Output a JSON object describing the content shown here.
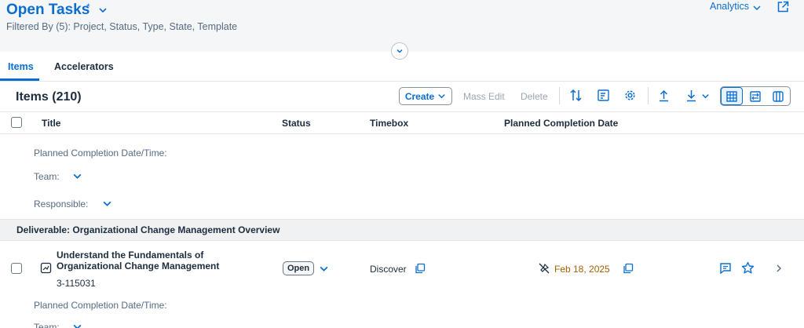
{
  "header": {
    "title": "Open Tasks",
    "title_marker": "*",
    "filter_text": "Filtered By (5): Project, Status, Type, State, Template",
    "analytics_label": "Analytics"
  },
  "tabs": [
    {
      "label": "Items",
      "selected": true
    },
    {
      "label": "Accelerators",
      "selected": false
    }
  ],
  "toolbar": {
    "title": "Items (210)",
    "create_label": "Create",
    "mass_edit_label": "Mass Edit",
    "delete_label": "Delete"
  },
  "columns": [
    "Title",
    "Status",
    "Timebox",
    "Planned Completion Date"
  ],
  "details_block": {
    "planned_label": "Planned Completion Date/Time:",
    "team_label": "Team:",
    "responsible_label": "Responsible:"
  },
  "group": {
    "label": "Deliverable: Organizational Change Management Overview"
  },
  "row": {
    "title": "Understand the Fundamentals of Organizational Change Management",
    "id": "3-115031",
    "status": "Open",
    "timebox": "Discover",
    "planned_date": "Feb 18, 2025",
    "planned_label": "Planned Completion Date/Time:",
    "team_label": "Team:"
  },
  "colors": {
    "accent": "#0a6ed1",
    "date_warning": "#a45d00",
    "text": "#1d2d3e",
    "muted": "#556b82"
  }
}
